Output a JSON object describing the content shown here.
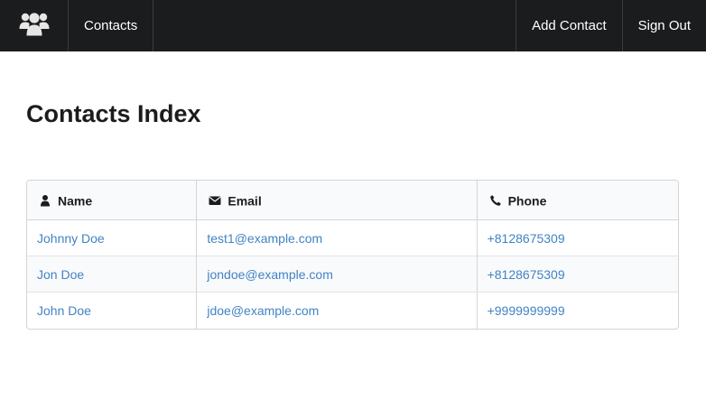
{
  "nav": {
    "logo_icon": "users-icon",
    "contacts_label": "Contacts",
    "add_contact_label": "Add Contact",
    "sign_out_label": "Sign Out"
  },
  "page": {
    "title": "Contacts Index"
  },
  "table": {
    "columns": [
      {
        "label": "Name",
        "icon": "user-icon"
      },
      {
        "label": "Email",
        "icon": "envelope-icon"
      },
      {
        "label": "Phone",
        "icon": "phone-icon"
      }
    ],
    "rows": [
      {
        "name": "Johnny Doe",
        "email": "test1@example.com",
        "phone": "+8128675309"
      },
      {
        "name": "Jon Doe",
        "email": "jondoe@example.com",
        "phone": "+8128675309"
      },
      {
        "name": "John Doe",
        "email": "jdoe@example.com",
        "phone": "+9999999999"
      }
    ]
  },
  "colors": {
    "navbar_bg": "#1b1c1d",
    "link": "#4183c4",
    "header_bg": "#f9fafb",
    "border": "#d4d4d5"
  }
}
